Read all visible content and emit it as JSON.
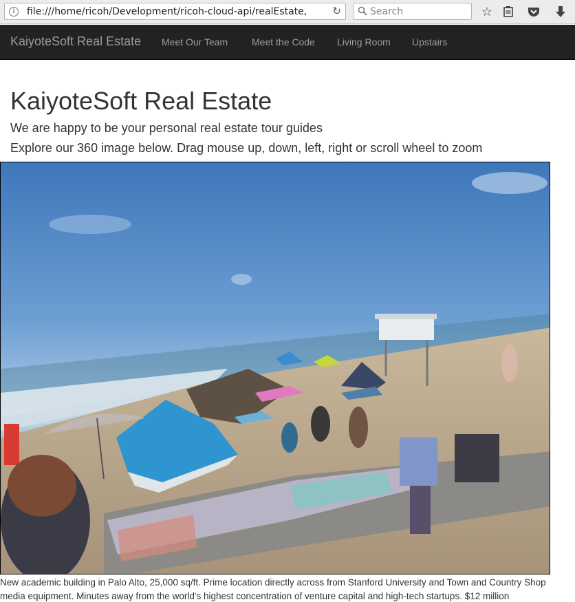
{
  "browser": {
    "url": "file:///home/ricoh/Development/ricoh-cloud-api/realEstate,",
    "search_placeholder": "Search"
  },
  "navbar": {
    "brand": "KaiyoteSoft Real Estate",
    "links": [
      "Meet Our Team",
      "Meet the Code",
      "Living Room",
      "Upstairs"
    ]
  },
  "main": {
    "title": "KaiyoteSoft Real Estate",
    "subtitle": "We are happy to be your personal real estate tour guides",
    "instructions": "Explore our 360 image below. Drag mouse up, down, left, right or scroll wheel to zoom",
    "description_line1": "New academic building in Palo Alto, 25,000 sq/ft. Prime location directly across from Stanford University and Town and Country Shop",
    "description_line2": "media equipment. Minutes away from the world's highest concentration of venture capital and high-tech startups. $12 million"
  },
  "icons": {
    "info": "info-icon",
    "reload": "reload-icon",
    "search": "search-icon",
    "bookmark": "star-icon",
    "reading_list": "clipboard-icon",
    "pocket": "pocket-icon",
    "downloads": "download-arrow-icon"
  },
  "colors": {
    "navbar_bg": "#222222",
    "navbar_text": "#9d9d9d",
    "sky": "#4d86c6",
    "sand": "#b5a48a"
  }
}
